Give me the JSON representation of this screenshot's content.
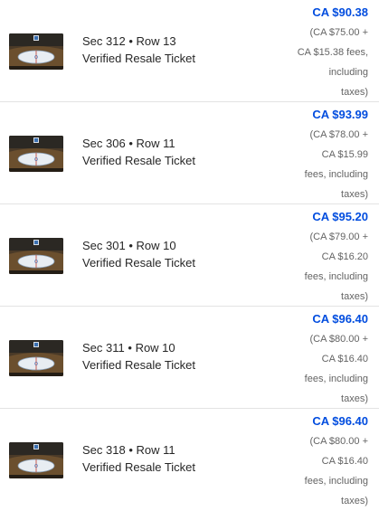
{
  "listings": [
    {
      "section": "Sec 312",
      "separator": "•",
      "row": "Row 13",
      "ticket_type": "Verified Resale Ticket",
      "price": "CA $90.38",
      "fee_lines": [
        "(CA $75.00 +",
        "CA $15.38 fees,",
        "including",
        "taxes)"
      ]
    },
    {
      "section": "Sec 306",
      "separator": "•",
      "row": "Row 11",
      "ticket_type": "Verified Resale Ticket",
      "price": "CA $93.99",
      "fee_lines": [
        "(CA $78.00 +",
        "CA $15.99",
        "fees, including",
        "taxes)"
      ]
    },
    {
      "section": "Sec 301",
      "separator": "•",
      "row": "Row 10",
      "ticket_type": "Verified Resale Ticket",
      "price": "CA $95.20",
      "fee_lines": [
        "(CA $79.00 +",
        "CA $16.20",
        "fees, including",
        "taxes)"
      ]
    },
    {
      "section": "Sec 311",
      "separator": "•",
      "row": "Row 10",
      "ticket_type": "Verified Resale Ticket",
      "price": "CA $96.40",
      "fee_lines": [
        "(CA $80.00 +",
        "CA $16.40",
        "fees, including",
        "taxes)"
      ]
    },
    {
      "section": "Sec 318",
      "separator": "•",
      "row": "Row 11",
      "ticket_type": "Verified Resale Ticket",
      "price": "CA $96.40",
      "fee_lines": [
        "(CA $80.00 +",
        "CA $16.40",
        "fees, including",
        "taxes)"
      ]
    }
  ],
  "colors": {
    "price": "#024ddf",
    "text": "#262626",
    "fees": "#646464",
    "divider": "#e3e3e3"
  }
}
